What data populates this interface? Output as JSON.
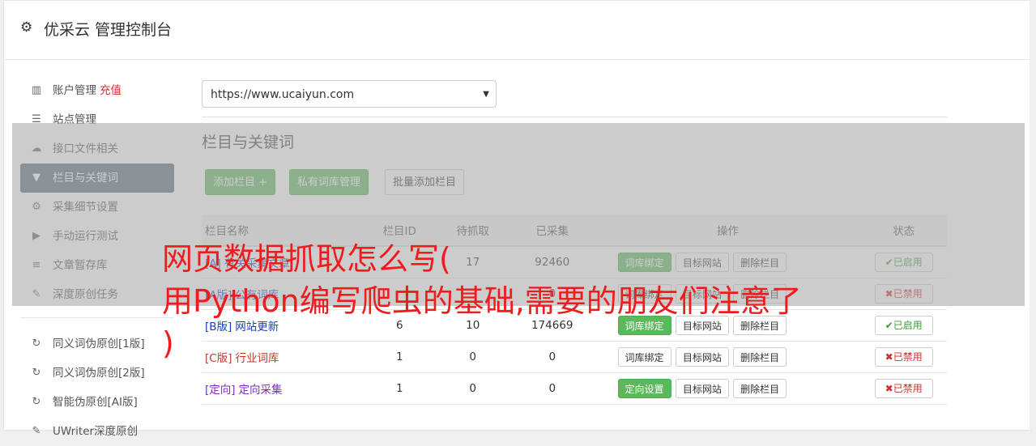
{
  "header": {
    "title": "优采云 管理控制台",
    "icon": "gear-icon"
  },
  "sidebar": {
    "items": [
      {
        "label": "账户管理",
        "extra": "充值",
        "icon": "bar-chart-icon",
        "glyph": "▥"
      },
      {
        "label": "站点管理",
        "icon": "server-icon",
        "glyph": "☰"
      },
      {
        "label": "接口文件相关",
        "icon": "cloud-upload-icon",
        "glyph": "☁"
      },
      {
        "label": "栏目与关键词",
        "icon": "filter-icon",
        "glyph": "▼",
        "active": true
      },
      {
        "label": "采集细节设置",
        "icon": "cogs-icon",
        "glyph": "⚙"
      },
      {
        "label": "手动运行测试",
        "icon": "play-circle-icon",
        "glyph": "▶"
      },
      {
        "label": "文章暂存库",
        "icon": "database-icon",
        "glyph": "≡"
      },
      {
        "label": "深度原创任务",
        "icon": "edit-icon",
        "glyph": "✎"
      }
    ],
    "items2": [
      {
        "label": "同义词伪原创[1版]",
        "icon": "refresh-icon",
        "glyph": "↻"
      },
      {
        "label": "同义词伪原创[2版]",
        "icon": "refresh-icon",
        "glyph": "↻"
      },
      {
        "label": "智能伪原创[AI版]",
        "icon": "refresh-icon",
        "glyph": "↻"
      },
      {
        "label": "UWriter深度原创",
        "icon": "edit-icon",
        "glyph": "✎"
      }
    ]
  },
  "main": {
    "site_select": "https://www.ucaiyun.com",
    "section_title": "栏目与关键词",
    "buttons": {
      "add_column": "添加栏目 +",
      "private_lib": "私有词库管理",
      "batch_add": "批量添加栏目"
    },
    "table": {
      "headers": [
        "栏目名称",
        "栏目ID",
        "待抓取",
        "已采集",
        "操作",
        "状态"
      ],
      "rows": [
        {
          "tag": "[A]",
          "name": "有关采集文章",
          "id": "",
          "wait": "17",
          "done": "92460",
          "op1": "词库绑定",
          "op1_green": true,
          "op2": "目标网站",
          "op3": "删除栏目",
          "status": "已启用",
          "on": true,
          "cls": "a"
        },
        {
          "tag": "[A版]",
          "name": "公有词库",
          "id": "",
          "wait": "",
          "done": "0",
          "op1": "词库绑定",
          "op1_green": false,
          "op2": "目标网站",
          "op3": "删除栏目",
          "status": "已禁用",
          "on": false,
          "cls": "a"
        },
        {
          "tag": "[B版]",
          "name": "网站更新",
          "id": "6",
          "wait": "10",
          "done": "174669",
          "op1": "词库绑定",
          "op1_green": true,
          "op2": "目标网站",
          "op3": "删除栏目",
          "status": "已启用",
          "on": true,
          "cls": "a"
        },
        {
          "tag": "[C版]",
          "name": "行业词库",
          "id": "1",
          "wait": "0",
          "done": "0",
          "op1": "词库绑定",
          "op1_green": false,
          "op2": "目标网站",
          "op3": "删除栏目",
          "status": "已禁用",
          "on": false,
          "cls": "c"
        },
        {
          "tag": "[定向]",
          "name": "定向采集",
          "id": "1",
          "wait": "0",
          "done": "0",
          "op1": "定向设置",
          "op1_green": true,
          "op2": "目标网站",
          "op3": "删除栏目",
          "status": "已禁用",
          "on": false,
          "cls": "d"
        }
      ]
    }
  },
  "watermark": {
    "line1": "网页数据抓取怎么写(",
    "line2": "用Python编写爬虫的基础,需要的朋友们注意了",
    "line3": ")"
  },
  "colors": {
    "accent_green": "#5cb85c",
    "sidebar_active": "#5b6b7b",
    "watermark_red": "#ee1c1c"
  }
}
